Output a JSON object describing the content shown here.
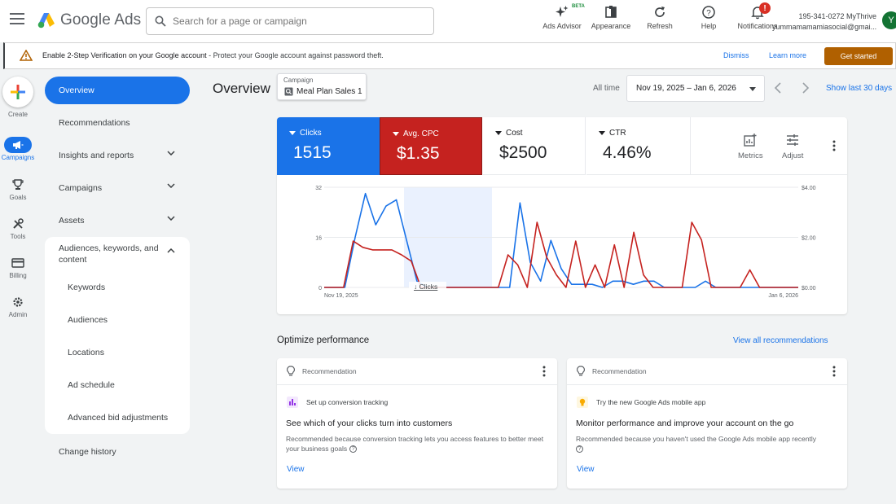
{
  "topbar": {
    "product_name": "Google Ads",
    "search_placeholder": "Search for a page or campaign",
    "icons": [
      {
        "label": "Ads Advisor",
        "icon": "sparkle-icon",
        "badge": "BETA"
      },
      {
        "label": "Appearance",
        "icon": "appearance-icon"
      },
      {
        "label": "Refresh",
        "icon": "refresh-icon"
      },
      {
        "label": "Help",
        "icon": "help-icon"
      },
      {
        "label": "Notifications",
        "icon": "bell-icon",
        "badge": "!"
      }
    ],
    "account_id": "195-341-0272 MyThrive",
    "account_email": "yummamamamiasocial@gmai...",
    "avatar_letter": "Y"
  },
  "banner": {
    "title": "Enable 2-Step Verification on your Google account",
    "text": " - Protect your Google account against password theft.",
    "dismiss": "Dismiss",
    "learn_more": "Learn more",
    "cta": "Get started"
  },
  "rail": [
    {
      "label": "Create",
      "icon": "plus-icon"
    },
    {
      "label": "Campaigns",
      "icon": "megaphone-icon",
      "active": true
    },
    {
      "label": "Goals",
      "icon": "trophy-icon"
    },
    {
      "label": "Tools",
      "icon": "tools-icon"
    },
    {
      "label": "Billing",
      "icon": "card-icon"
    },
    {
      "label": "Admin",
      "icon": "gear-icon"
    }
  ],
  "nav": {
    "overview": "Overview",
    "recommendations": "Recommendations",
    "insights": "Insights and reports",
    "campaigns": "Campaigns",
    "assets": "Assets",
    "audiences": "Audiences, keywords, and content",
    "sub": [
      "Keywords",
      "Audiences",
      "Locations",
      "Ad schedule",
      "Advanced bid adjustments"
    ],
    "change_history": "Change history"
  },
  "header": {
    "title": "Overview",
    "campaign_label": "Campaign",
    "campaign_value": "Meal Plan Sales 1",
    "all_time": "All time",
    "date_range": "Nov 19, 2025 – Jan 6, 2026",
    "show_last": "Show last 30 days"
  },
  "metrics": [
    {
      "label": "Clicks",
      "value": "1515",
      "color": "#1a73e8"
    },
    {
      "label": "Avg. CPC",
      "value": "$1.35",
      "color": "#c5221f"
    },
    {
      "label": "Cost",
      "value": "$2500"
    },
    {
      "label": "CTR",
      "value": "4.46%"
    }
  ],
  "metric_tools": {
    "metrics": "Metrics",
    "adjust": "Adjust"
  },
  "chart_data": {
    "type": "line",
    "x_start_label": "Nov 19, 2025",
    "x_end_label": "Jan 6, 2026",
    "left_axis_ticks": [
      "32",
      "16",
      "0"
    ],
    "right_axis_ticks": [
      "$4.00",
      "$2.00",
      "$0.00"
    ],
    "ylim_left": [
      0,
      32
    ],
    "ylim_right": [
      0,
      4
    ],
    "hover_label": "Clicks",
    "series": [
      {
        "name": "Clicks",
        "color": "#1a73e8",
        "values": [
          0,
          0,
          0,
          16,
          30,
          20,
          26,
          28,
          15,
          2,
          0,
          0,
          0,
          0,
          0,
          0,
          0,
          0,
          0,
          27,
          8,
          2,
          15,
          6,
          1,
          1,
          1,
          0,
          2,
          2,
          1,
          2,
          2,
          0,
          0,
          0,
          0,
          2,
          0,
          0,
          0,
          0,
          0,
          0,
          0,
          0,
          0
        ]
      },
      {
        "name": "Avg. CPC",
        "color": "#c5221f",
        "values": [
          0,
          0,
          0,
          1.85,
          1.6,
          1.5,
          1.5,
          1.5,
          1.3,
          1.05,
          0,
          0,
          0,
          0,
          0,
          0,
          0,
          0,
          0,
          1.3,
          0.9,
          0,
          2.6,
          1.2,
          0.5,
          0,
          1.85,
          0,
          0.9,
          0,
          1.7,
          0,
          2.2,
          0.5,
          0,
          0,
          0,
          0,
          2.6,
          1.9,
          0,
          0,
          0,
          0,
          0.7,
          0,
          0,
          0,
          0,
          0
        ]
      }
    ]
  },
  "optimize": {
    "title": "Optimize performance",
    "view_all": "View all recommendations",
    "cards": [
      {
        "header": "Recommendation",
        "sub": "Set up conversion tracking",
        "title": "See which of your clicks turn into customers",
        "desc": "Recommended because conversion tracking lets you access features to better meet your business goals",
        "view": "View"
      },
      {
        "header": "Recommendation",
        "sub": "Try the new Google Ads mobile app",
        "title": "Monitor performance and improve your account on the go",
        "desc": "Recommended because you haven't used the Google Ads mobile app recently",
        "view": "View"
      }
    ]
  }
}
